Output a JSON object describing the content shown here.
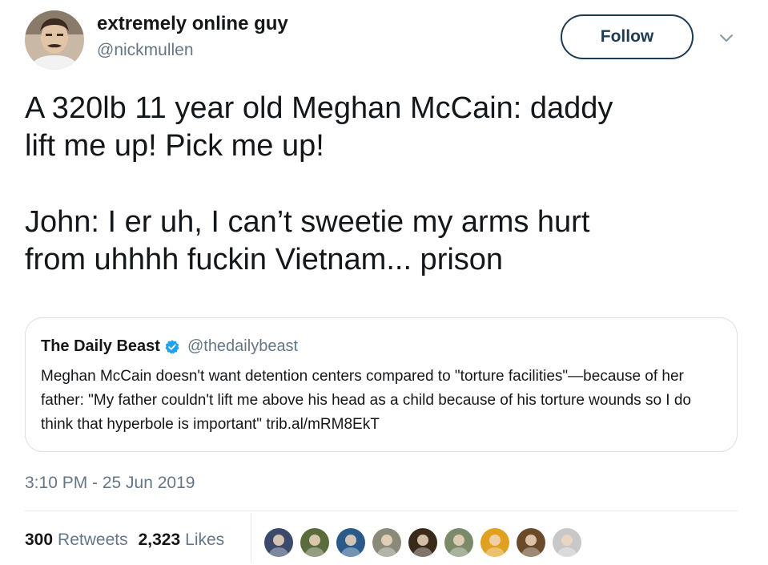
{
  "author": {
    "display_name": "extremely online guy",
    "handle": "@nickmullen",
    "avatar_icon": "user-avatar"
  },
  "follow_button": {
    "label": "Follow",
    "color": "#1f3a53"
  },
  "more_menu_icon": "chevron-down-icon",
  "tweet": {
    "paragraph_1": "A 320lb 11 year old Meghan McCain: daddy\nlift me up! Pick me up!",
    "paragraph_2": "John: I er uh, I can’t sweetie my arms hurt\nfrom uhhhh fuckin Vietnam... prison"
  },
  "quoted_tweet": {
    "author_name": "The Daily Beast",
    "verified_icon": "verified-badge-icon",
    "verified_color": "#1da1f2",
    "handle": "@thedailybeast",
    "text": "Meghan McCain doesn't want detention centers compared to \"torture facilities\"—because of her father: \"My father couldn't lift me above his head as a child because of his torture wounds so I do think that hyperbole is important\" trib.al/mRM8EkT"
  },
  "timestamp": "3:10 PM - 25 Jun 2019",
  "stats": {
    "retweets_count": "300",
    "retweets_label": "Retweets",
    "likes_count": "2,323",
    "likes_label": "Likes"
  },
  "liker_avatars": [
    {
      "icon": "user-avatar",
      "bg": "#3b4a6b"
    },
    {
      "icon": "user-avatar",
      "bg": "#5a6b3c"
    },
    {
      "icon": "user-avatar",
      "bg": "#2a5a8a"
    },
    {
      "icon": "user-avatar",
      "bg": "#8a8a7a"
    },
    {
      "icon": "user-avatar",
      "bg": "#3a2a1a"
    },
    {
      "icon": "user-avatar",
      "bg": "#7a8a6a"
    },
    {
      "icon": "user-avatar",
      "bg": "#e0a020"
    },
    {
      "icon": "user-avatar",
      "bg": "#6a4a2a"
    },
    {
      "icon": "user-avatar",
      "bg": "#c8c8c8"
    }
  ]
}
